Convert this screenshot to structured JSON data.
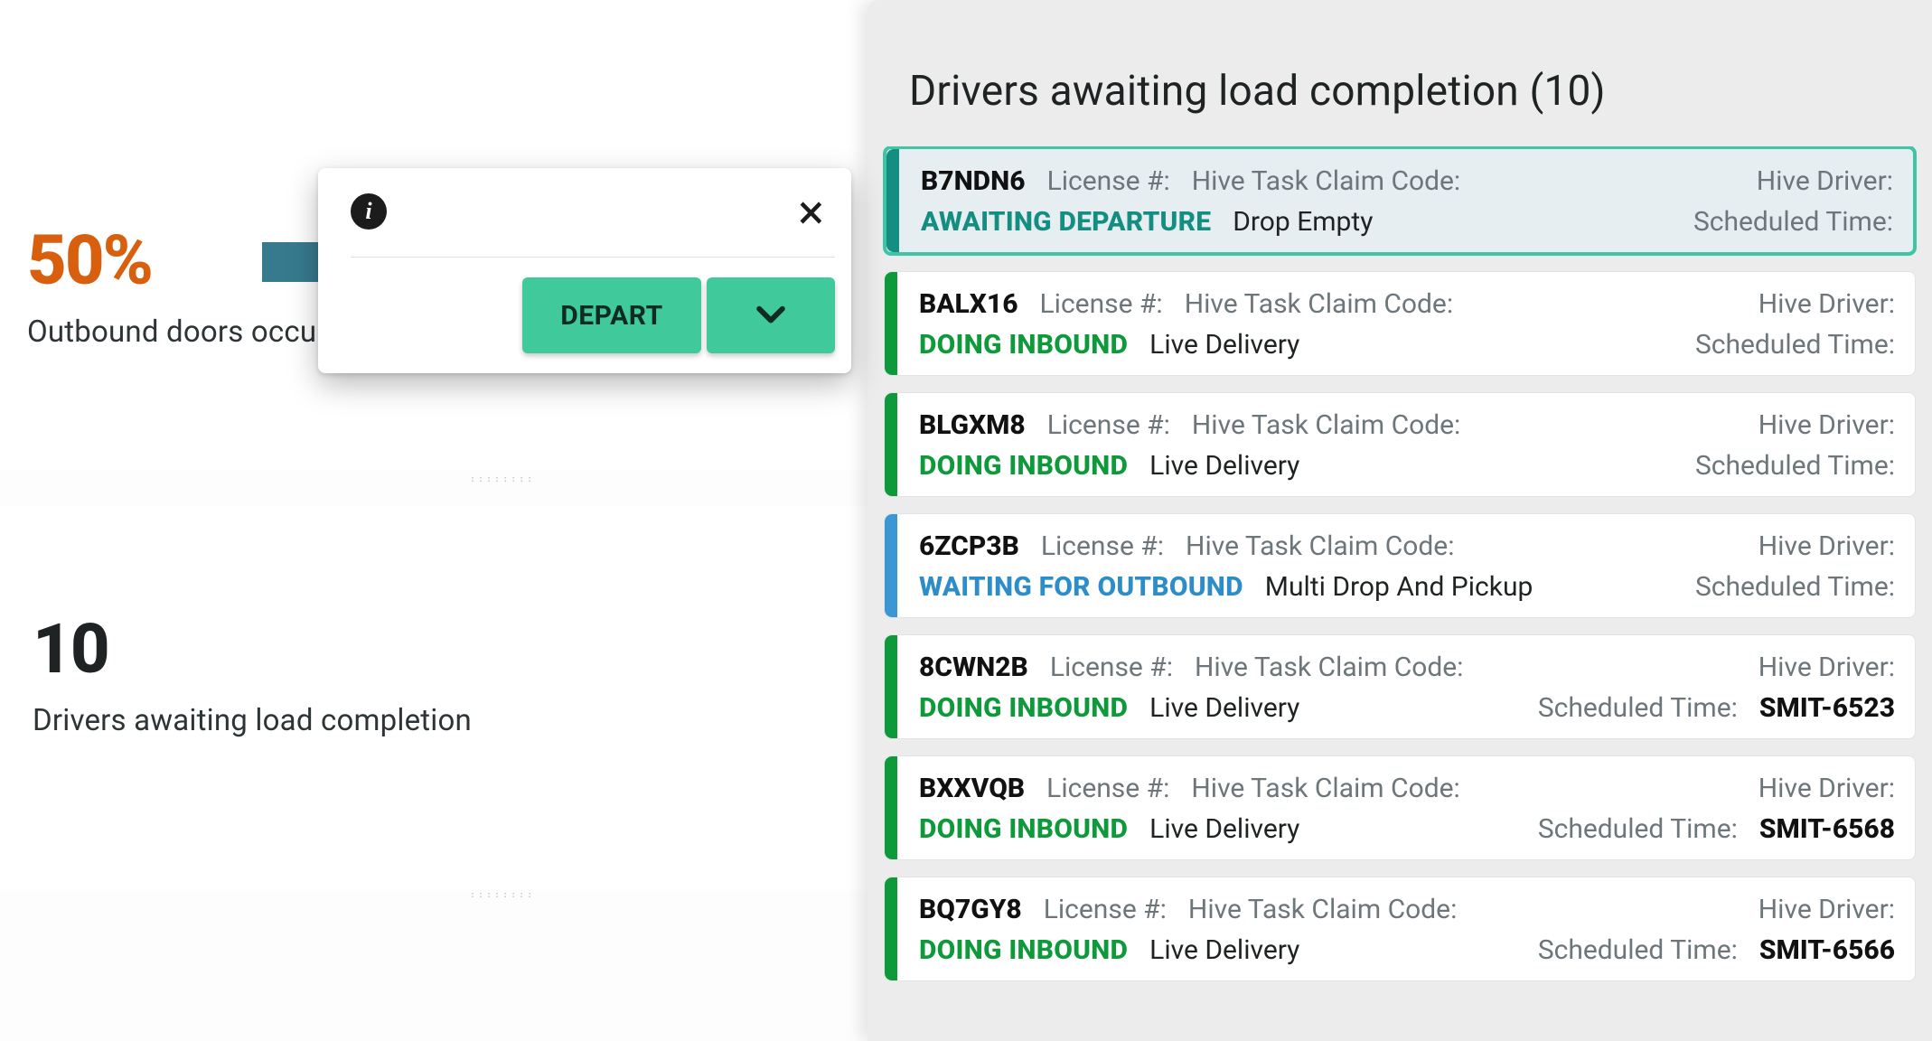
{
  "stats": {
    "outbound_percent": "50%",
    "outbound_label": "Outbound doors occu",
    "awaiting_count": "10",
    "awaiting_label": "Drivers awaiting load completion"
  },
  "popover": {
    "depart_label": "DEPART"
  },
  "panel": {
    "title": "Drivers awaiting load completion (10)"
  },
  "labels": {
    "license": "License #:",
    "claim": "Hive Task Claim Code:",
    "hive_driver": "Hive Driver:",
    "scheduled": "Scheduled Time:"
  },
  "drivers": [
    {
      "code": "B7NDN6",
      "status": "AWAITING DEPARTURE",
      "status_color": "teal",
      "accent": "teal",
      "task": "Drop Empty",
      "sched": "",
      "selected": true
    },
    {
      "code": "BALX16",
      "status": "DOING INBOUND",
      "status_color": "green",
      "accent": "green",
      "task": "Live Delivery",
      "sched": "",
      "selected": false
    },
    {
      "code": "BLGXM8",
      "status": "DOING INBOUND",
      "status_color": "green",
      "accent": "green",
      "task": "Live Delivery",
      "sched": "",
      "selected": false
    },
    {
      "code": "6ZCP3B",
      "status": "WAITING FOR OUTBOUND",
      "status_color": "blue",
      "accent": "blue",
      "task": "Multi Drop And Pickup",
      "sched": "",
      "selected": false
    },
    {
      "code": "8CWN2B",
      "status": "DOING INBOUND",
      "status_color": "green",
      "accent": "green",
      "task": "Live Delivery",
      "sched": "SMIT-6523",
      "selected": false
    },
    {
      "code": "BXXVQB",
      "status": "DOING INBOUND",
      "status_color": "green",
      "accent": "green",
      "task": "Live Delivery",
      "sched": "SMIT-6568",
      "selected": false
    },
    {
      "code": "BQ7GY8",
      "status": "DOING INBOUND",
      "status_color": "green",
      "accent": "green",
      "task": "Live Delivery",
      "sched": "SMIT-6566",
      "selected": false
    }
  ]
}
